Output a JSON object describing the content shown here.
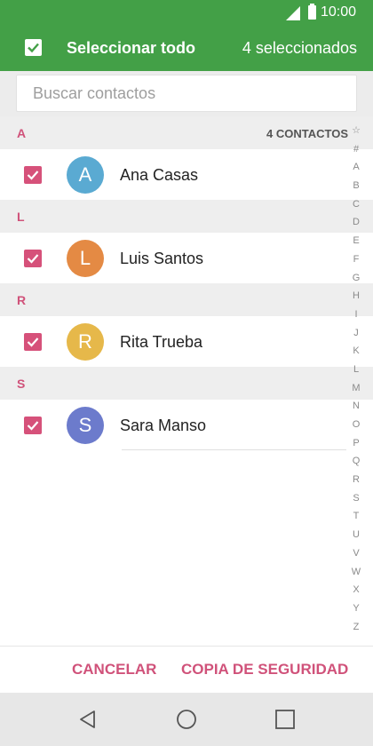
{
  "status_bar": {
    "time": "10:00"
  },
  "app_bar": {
    "title": "Seleccionar todo",
    "selected_count": "4 seleccionados"
  },
  "search": {
    "placeholder": "Buscar contactos",
    "value": ""
  },
  "contact_count": "4 CONTACTOS",
  "sections": [
    {
      "letter": "A",
      "contacts": [
        {
          "name": "Ana Casas",
          "initial": "A",
          "color": "#5aaad2",
          "checked": true
        }
      ]
    },
    {
      "letter": "L",
      "contacts": [
        {
          "name": "Luis Santos",
          "initial": "L",
          "color": "#e48a44",
          "checked": true
        }
      ]
    },
    {
      "letter": "R",
      "contacts": [
        {
          "name": "Rita Trueba",
          "initial": "R",
          "color": "#e6b84a",
          "checked": true
        }
      ]
    },
    {
      "letter": "S",
      "contacts": [
        {
          "name": "Sara Manso",
          "initial": "S",
          "color": "#6c7bcc",
          "checked": true
        }
      ]
    }
  ],
  "index_letters": [
    "☆",
    "#",
    "A",
    "B",
    "C",
    "D",
    "E",
    "F",
    "G",
    "H",
    "I",
    "J",
    "K",
    "L",
    "M",
    "N",
    "O",
    "P",
    "Q",
    "R",
    "S",
    "T",
    "U",
    "V",
    "W",
    "X",
    "Y",
    "Z"
  ],
  "actions": {
    "cancel": "CANCELAR",
    "backup": "COPIA DE SEGURIDAD"
  },
  "colors": {
    "app_bar": "#43a047",
    "accent": "#d0527a",
    "checkbox": "#d6517a"
  },
  "nav": {
    "back": "back-icon",
    "home": "home-icon",
    "recents": "recents-icon"
  }
}
